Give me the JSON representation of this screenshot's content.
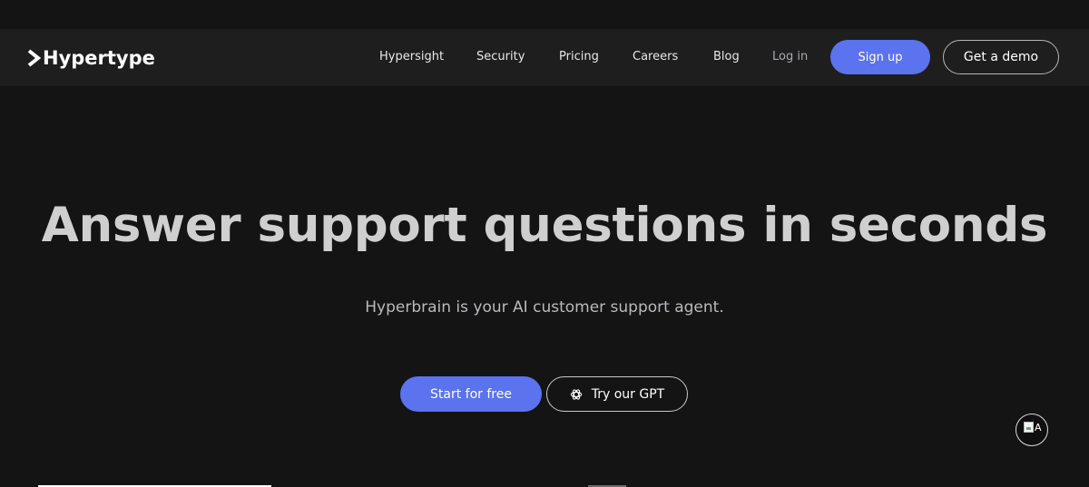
{
  "brand": {
    "name": "Hypertype"
  },
  "nav": {
    "links": [
      {
        "label": "Hypersight"
      },
      {
        "label": "Security"
      },
      {
        "label": "Pricing"
      },
      {
        "label": "Careers"
      },
      {
        "label": "Blog"
      }
    ],
    "login_label": "Log in",
    "signup_label": "Sign up",
    "demo_label": "Get a demo"
  },
  "hero": {
    "title": "Answer support questions in seconds",
    "subtitle": "Hyperbrain is your AI customer support agent.",
    "primary_cta": "Start for free",
    "secondary_cta": "Try our GPT"
  },
  "chat_widget": {
    "alt_text": "A",
    "icon": "broken-image-icon"
  },
  "colors": {
    "background": "#141414",
    "navbar": "#1e1e1e",
    "accent": "#5b73ef",
    "title": "#cfcfcf"
  },
  "icons": {
    "logo": "chevron-right-icon",
    "gpt": "openai-knot-icon"
  }
}
